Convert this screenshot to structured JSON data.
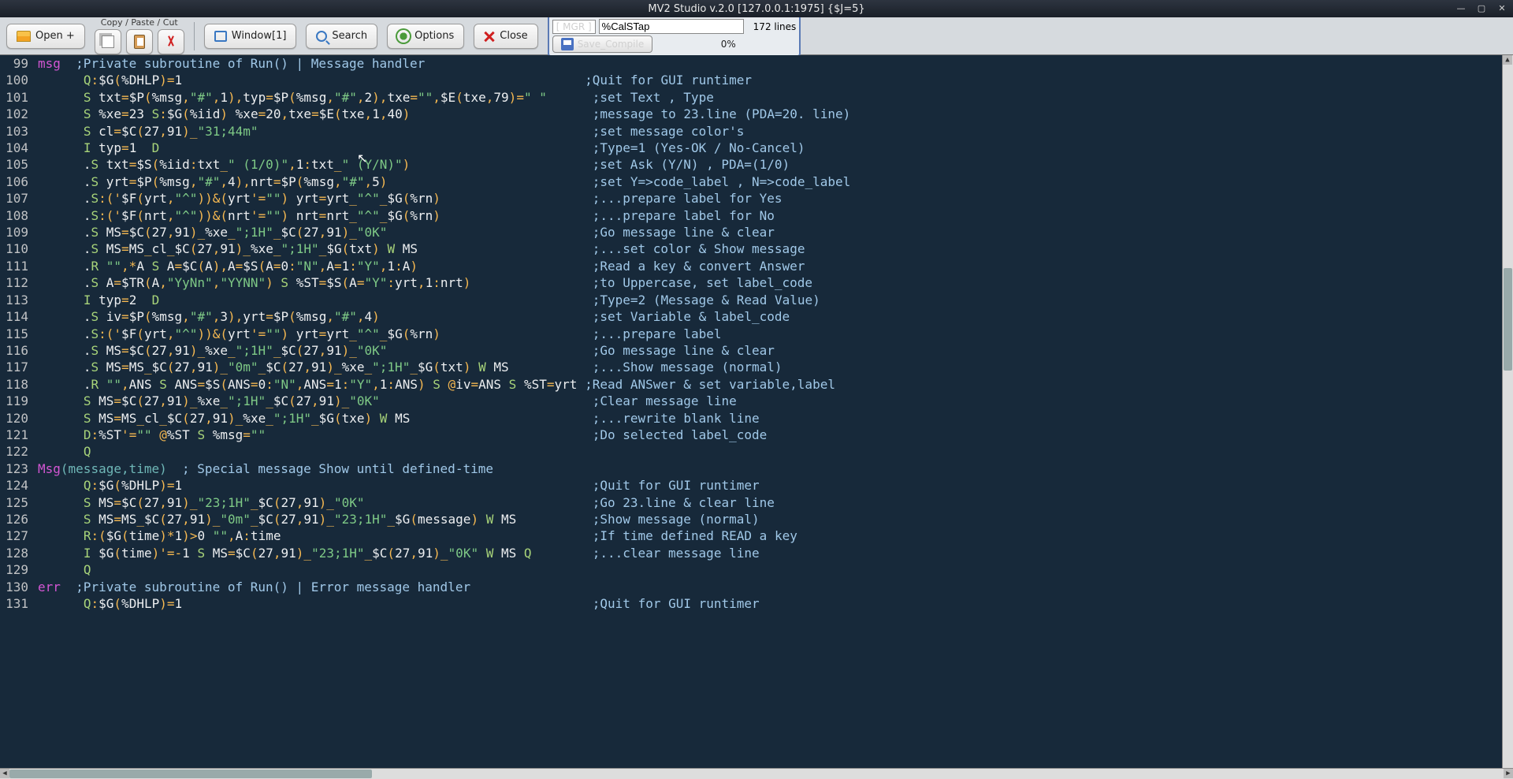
{
  "window": {
    "title": "MV2 Studio v.2.0 [127.0.0.1:1975]  {$J=5}"
  },
  "toolbar": {
    "open": "Open +",
    "cpc_label": "Copy / Paste / Cut",
    "window": "Window[1]",
    "search": "Search",
    "options": "Options",
    "close": "Close"
  },
  "file": {
    "namespace": "[ MGR   ]",
    "routine": "%CalSTap",
    "lines": "172 lines",
    "save": "Save_Compile",
    "progress": "0%"
  },
  "code": [
    {
      "n": "99",
      "l": "msg",
      "c": "  ;Private subroutine of Run() | Message handler",
      "cls": "cmt",
      "lc": "lbl"
    },
    {
      "n": "100",
      "c": "      Q:$G(%DHLP)=1                                                     ;Quit for GUI runtimer"
    },
    {
      "n": "101",
      "c": "      S txt=$P(%msg,\"#\",1),typ=$P(%msg,\"#\",2),txe=\"\",$E(txe,79)=\" \"      ;set Text , Type"
    },
    {
      "n": "102",
      "c": "      S %xe=23 S:$G(%iid) %xe=20,txe=$E(txe,1,40)                        ;message to 23.line (PDA=20. line)"
    },
    {
      "n": "103",
      "c": "      S cl=$C(27,91)_\"31;44m\"                                            ;set message color's"
    },
    {
      "n": "104",
      "c": "      I typ=1  D                                                         ;Type=1 (Yes-OK / No-Cancel)"
    },
    {
      "n": "105",
      "c": "      .S txt=$S(%iid:txt_\" (1/0)\",1:txt_\" (Y/N)\")                        ;set Ask (Y/N) , PDA=(1/0)"
    },
    {
      "n": "106",
      "c": "      .S yrt=$P(%msg,\"#\",4),nrt=$P(%msg,\"#\",5)                           ;set Y=>code_label , N=>code_label"
    },
    {
      "n": "107",
      "c": "      .S:('$F(yrt,\"^\"))&(yrt'=\"\") yrt=yrt_\"^\"_$G(%rn)                    ;...prepare label for Yes"
    },
    {
      "n": "108",
      "c": "      .S:('$F(nrt,\"^\"))&(nrt'=\"\") nrt=nrt_\"^\"_$G(%rn)                    ;...prepare label for No"
    },
    {
      "n": "109",
      "c": "      .S MS=$C(27,91)_%xe_\";1H\"_$C(27,91)_\"0K\"                           ;Go message line & clear"
    },
    {
      "n": "110",
      "c": "      .S MS=MS_cl_$C(27,91)_%xe_\";1H\"_$G(txt) W MS                       ;...set color & Show message"
    },
    {
      "n": "111",
      "c": "      .R \"\",*A S A=$C(A),A=$S(A=0:\"N\",A=1:\"Y\",1:A)                       ;Read a key & convert Answer"
    },
    {
      "n": "112",
      "c": "      .S A=$TR(A,\"YyNn\",\"YYNN\") S %ST=$S(A=\"Y\":yrt,1:nrt)                ;to Uppercase, set label_code"
    },
    {
      "n": "113",
      "c": "      I typ=2  D                                                         ;Type=2 (Message & Read Value)"
    },
    {
      "n": "114",
      "c": "      .S iv=$P(%msg,\"#\",3),yrt=$P(%msg,\"#\",4)                            ;set Variable & label_code"
    },
    {
      "n": "115",
      "c": "      .S:('$F(yrt,\"^\"))&(yrt'=\"\") yrt=yrt_\"^\"_$G(%rn)                    ;...prepare label"
    },
    {
      "n": "116",
      "c": "      .S MS=$C(27,91)_%xe_\";1H\"_$C(27,91)_\"0K\"                           ;Go message line & clear"
    },
    {
      "n": "117",
      "c": "      .S MS=MS_$C(27,91)_\"0m\"_$C(27,91)_%xe_\";1H\"_$G(txt) W MS           ;...Show message (normal)"
    },
    {
      "n": "118",
      "c": "      .R \"\",ANS S ANS=$S(ANS=0:\"N\",ANS=1:\"Y\",1:ANS) S @iv=ANS S %ST=yrt ;Read ANSwer & set variable,label"
    },
    {
      "n": "119",
      "c": "      S MS=$C(27,91)_%xe_\";1H\"_$C(27,91)_\"0K\"                            ;Clear message line"
    },
    {
      "n": "120",
      "c": "      S MS=MS_cl_$C(27,91)_%xe_\";1H\"_$G(txe) W MS                        ;...rewrite blank line"
    },
    {
      "n": "121",
      "c": "      D:%ST'=\"\" @%ST S %msg=\"\"                                           ;Do selected label_code"
    },
    {
      "n": "122",
      "c": "      Q"
    },
    {
      "n": "123",
      "l": "Msg",
      "a": "(message,time)",
      "c": "  ; Special message Show until defined-time",
      "cls": "cmt",
      "lc": "lbl"
    },
    {
      "n": "124",
      "c": "      Q:$G(%DHLP)=1                                                      ;Quit for GUI runtimer"
    },
    {
      "n": "125",
      "c": "      S MS=$C(27,91)_\"23;1H\"_$C(27,91)_\"0K\"                              ;Go 23.line & clear line"
    },
    {
      "n": "126",
      "c": "      S MS=MS_$C(27,91)_\"0m\"_$C(27,91)_\"23;1H\"_$G(message) W MS          ;Show message (normal)"
    },
    {
      "n": "127",
      "c": "      R:($G(time)*1)>0 \"\",A:time                                         ;If time defined READ a key"
    },
    {
      "n": "128",
      "c": "      I $G(time)'=-1 S MS=$C(27,91)_\"23;1H\"_$C(27,91)_\"0K\" W MS Q        ;...clear message line"
    },
    {
      "n": "129",
      "c": "      Q"
    },
    {
      "n": "130",
      "l": "err",
      "c": "  ;Private subroutine of Run() | Error message handler",
      "cls": "cmt",
      "lc": "lbl"
    },
    {
      "n": "131",
      "c": "      Q:$G(%DHLP)=1                                                      ;Quit for GUI runtimer"
    }
  ]
}
